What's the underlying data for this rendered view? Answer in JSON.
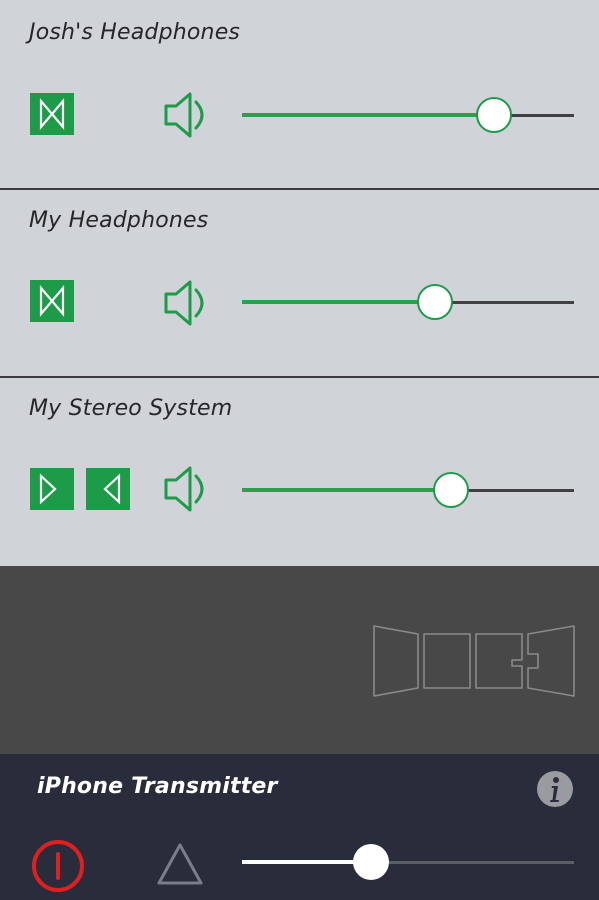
{
  "devices": [
    {
      "name": "Josh's Headphones",
      "mode": "stereo-combined",
      "volume": 0.76
    },
    {
      "name": "My Headphones",
      "mode": "stereo-combined",
      "volume": 0.58
    },
    {
      "name": "My Stereo System",
      "mode": "left-right-split",
      "volume": 0.63
    }
  ],
  "icons": {
    "channel": "bowtie-channel-icon",
    "left": "left-channel-icon",
    "right": "right-channel-icon",
    "speaker": "speaker-icon",
    "bay": "speaker-group-outline-icon",
    "info": "info-icon",
    "power": "power-icon",
    "warning": "triangle-icon"
  },
  "transmitter": {
    "title": "iPhone Transmitter",
    "volume": 0.39
  },
  "colors": {
    "accent_green": "#1e9b48",
    "panel": "#d0d3d8",
    "bay": "#484848",
    "transmitter_bg": "#282c3b",
    "power_red": "#e02020"
  }
}
